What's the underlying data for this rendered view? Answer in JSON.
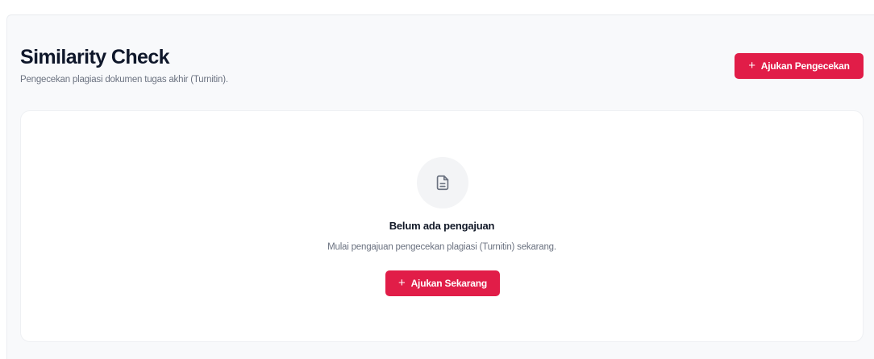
{
  "header": {
    "title": "Similarity Check",
    "subtitle": "Pengecekan plagiasi dokumen tugas akhir (Turnitin).",
    "primary_action": {
      "icon": "plus-icon",
      "symbol": "+",
      "label": "Ajukan Pengecekan"
    }
  },
  "empty_state": {
    "icon": "document-icon",
    "title": "Belum ada pengajuan",
    "description": "Mulai pengajuan pengecekan plagiasi (Turnitin) sekarang.",
    "action": {
      "icon": "plus-icon",
      "symbol": "+",
      "label": "Ajukan Sekarang"
    }
  },
  "colors": {
    "accent": "#e11d48",
    "page_background": "#f8f9fb",
    "card_background": "#ffffff",
    "icon_circle": "#f3f4f6",
    "icon_stroke": "#6b7280"
  }
}
